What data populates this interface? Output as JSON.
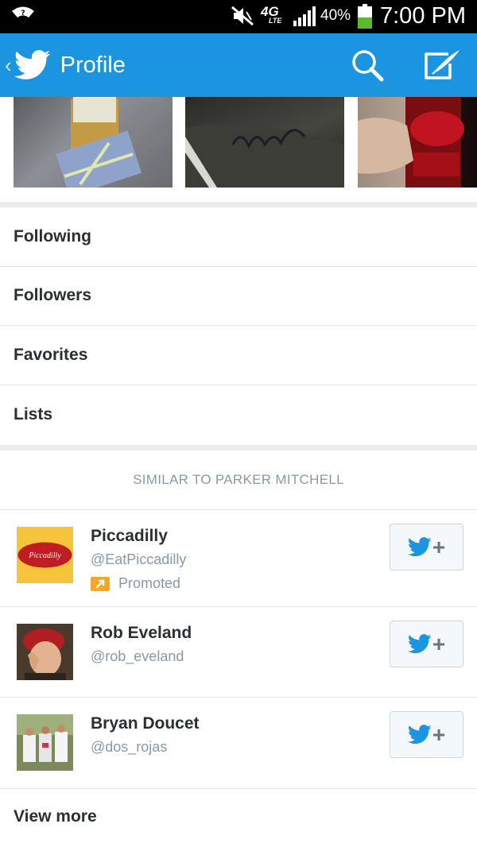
{
  "status_bar": {
    "network": "4G",
    "network_sub": "LTE",
    "battery": "40%",
    "time": "7:00 PM"
  },
  "app_bar": {
    "title": "Profile"
  },
  "menu": {
    "items": [
      {
        "label": "Following"
      },
      {
        "label": "Followers"
      },
      {
        "label": "Favorites"
      },
      {
        "label": "Lists"
      }
    ]
  },
  "similar": {
    "header": "SIMILAR TO PARKER MITCHELL",
    "users": [
      {
        "name": "Piccadilly",
        "handle": "@EatPiccadilly",
        "promoted": "Promoted",
        "avatar_text": "Piccadilly"
      },
      {
        "name": "Rob Eveland",
        "handle": "@rob_eveland"
      },
      {
        "name": "Bryan Doucet",
        "handle": "@dos_rojas"
      }
    ],
    "view_more": "View more"
  },
  "colors": {
    "brand_blue": "#1b95e0",
    "bird_blue": "#55acee",
    "promoted_orange": "#f5a623"
  }
}
